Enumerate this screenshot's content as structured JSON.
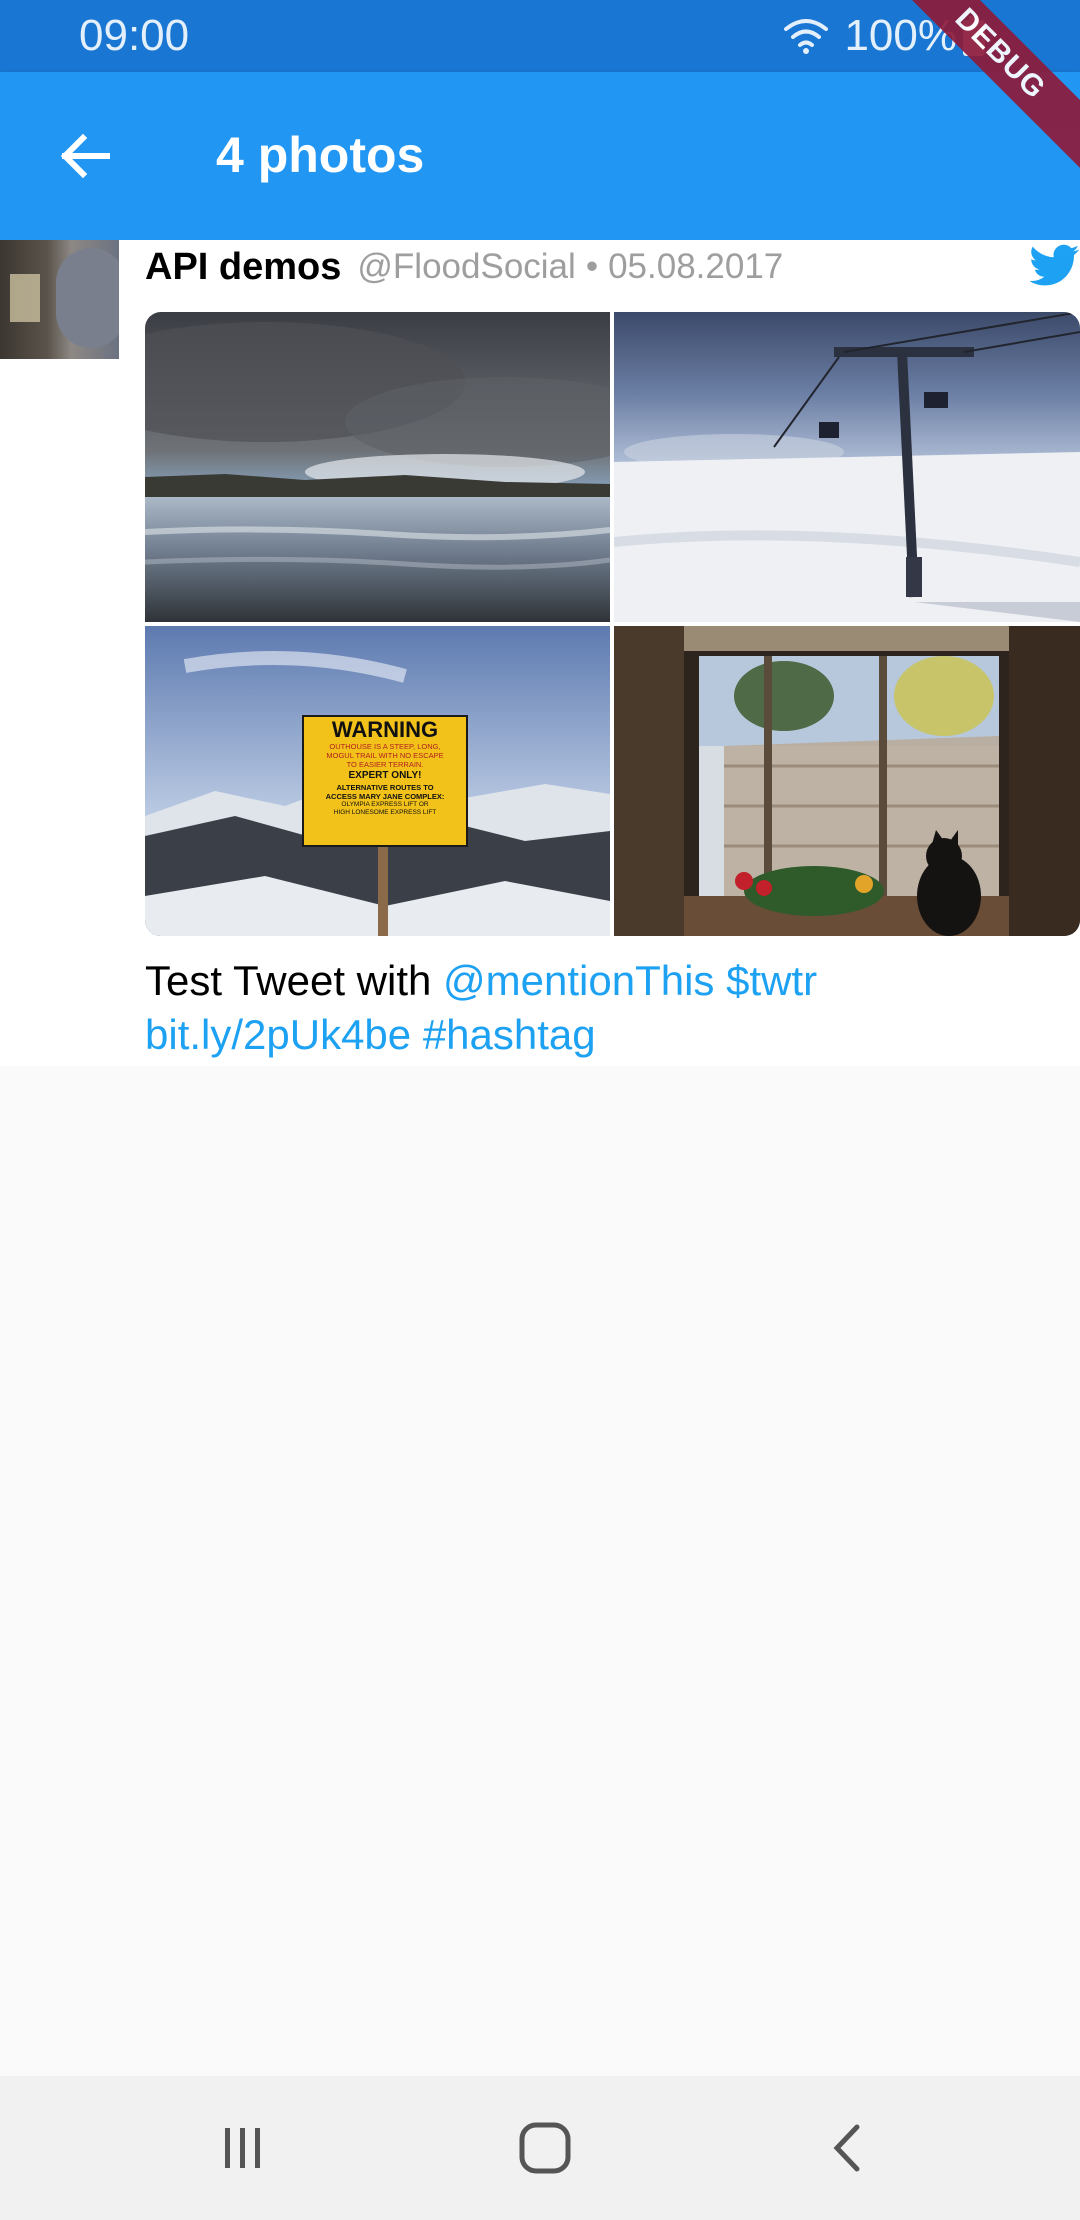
{
  "status_bar": {
    "time": "09:00",
    "battery": "100%"
  },
  "app_bar": {
    "title": "4 photos"
  },
  "debug_banner": {
    "label": "DEBUG"
  },
  "tweet": {
    "author_name": "API demos",
    "handle": "@FloodSocial",
    "separator": "•",
    "date": "05.08.2017",
    "text_plain": "Test Tweet with ",
    "text_mention": "@mentionThis",
    "text_cashtag": "$twtr",
    "text_url": "bit.ly/2pUk4be",
    "text_hashtag": "#hashtag",
    "link_color": "#1da1f2"
  },
  "photos": [
    {
      "subject": "lake-clouds"
    },
    {
      "subject": "ski-lift"
    },
    {
      "subject": "warning-sign",
      "sign_title": "WARNING",
      "sign_line1": "OUTHOUSE IS A STEEP, LONG,",
      "sign_line2": "MOGUL TRAIL WITH NO ESCAPE",
      "sign_line3": "TO EASIER TERRAIN.",
      "sign_line4": "EXPERT ONLY!",
      "sign_line5": "ALTERNATIVE ROUTES TO",
      "sign_line6": "ACCESS MARY JANE COMPLEX:",
      "sign_line7": "OLYMPIA EXPRESS LIFT OR",
      "sign_line8": "HIGH LONESOME EXPRESS LIFT"
    },
    {
      "subject": "window-cat"
    }
  ],
  "colors": {
    "app_bar": "#2196f3",
    "status_bar": "#1976d2",
    "background": "#fafafa"
  },
  "icons": {
    "back": "arrow-left-icon",
    "brand": "twitter-bird-icon",
    "nav": [
      "recent-apps-icon",
      "home-icon",
      "back-icon"
    ]
  }
}
